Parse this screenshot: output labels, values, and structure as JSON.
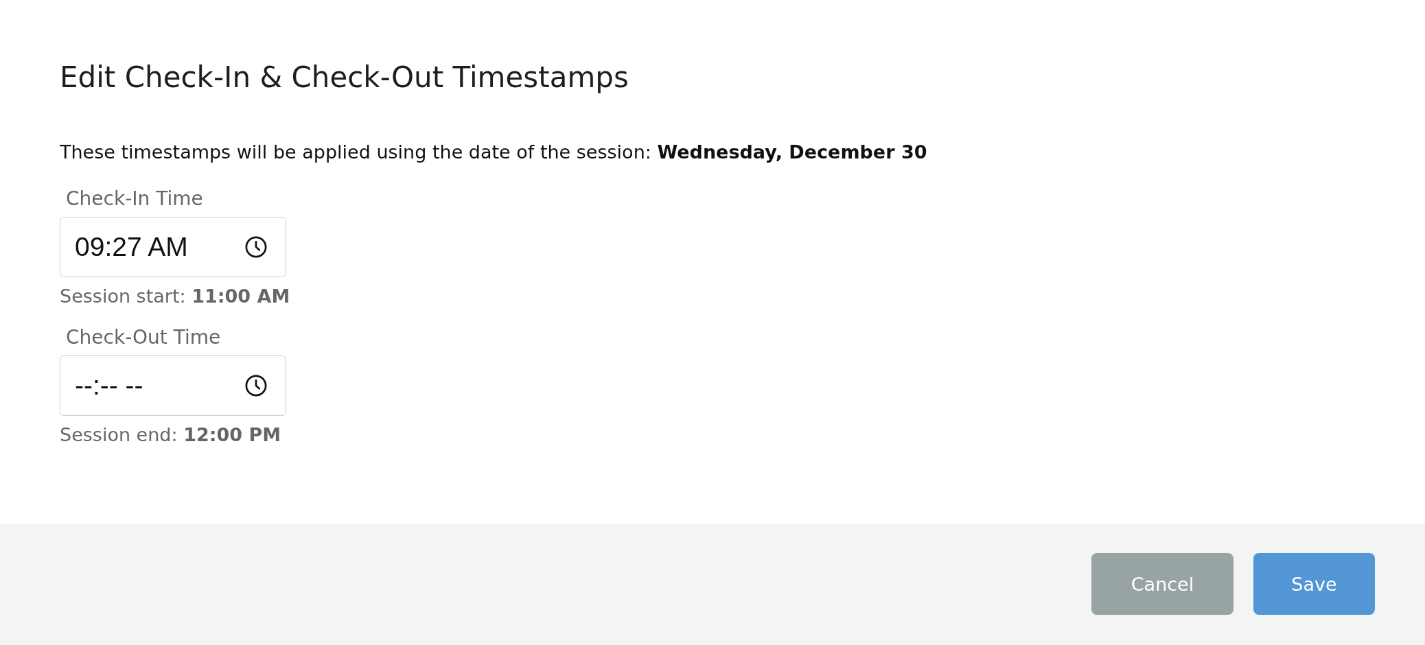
{
  "dialog": {
    "title": "Edit Check-In & Check-Out Timestamps",
    "description": "These timestamps will be applied using the date of the session: **Wednesday, December 30**",
    "fields": [
      {
        "label": "Check-In Time",
        "value": "09:27 AM",
        "hint": "Session start: **11:00 AM**"
      },
      {
        "label": "Check-Out Time",
        "placeholder": "--:-- --",
        "hint": "Session end: **12:00 PM**"
      }
    ]
  },
  "buttons": [
    {
      "label": "Cancel",
      "kind": "secondary"
    },
    {
      "label": "Save",
      "kind": "primary"
    }
  ]
}
